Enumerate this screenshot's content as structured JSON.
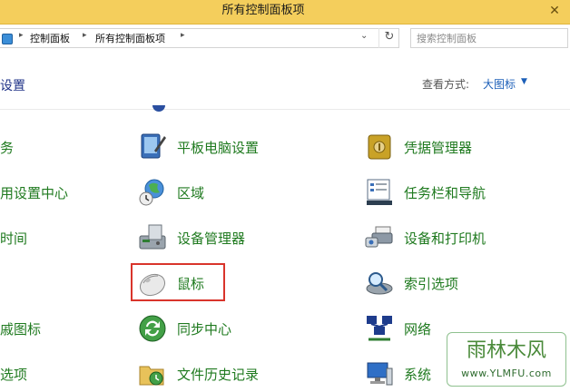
{
  "window": {
    "title": "所有控制面板项",
    "close_glyph": "✕"
  },
  "address_bar": {
    "crumbs": [
      "控制面板",
      "所有控制面板项"
    ],
    "separator": "▸",
    "dropdown_glyph": "⌄",
    "refresh_glyph": "↻"
  },
  "search": {
    "placeholder": "搜索控制面板"
  },
  "header": {
    "title_fragment": "设置",
    "view_label": "查看方式:",
    "view_value": "大图标",
    "view_caret": "▼"
  },
  "left_fragments": [
    "务",
    "用设置中心",
    "时间",
    "戚图标",
    "选项"
  ],
  "items_col2": [
    {
      "label": "平板电脑设置",
      "icon": "tablet-pc-settings-icon"
    },
    {
      "label": "区域",
      "icon": "region-globe-icon"
    },
    {
      "label": "设备管理器",
      "icon": "device-manager-icon"
    },
    {
      "label": "鼠标",
      "icon": "mouse-icon"
    },
    {
      "label": "同步中心",
      "icon": "sync-center-icon"
    },
    {
      "label": "文件历史记录",
      "icon": "file-history-icon"
    }
  ],
  "items_col3": [
    {
      "label": "凭据管理器",
      "icon": "credential-manager-icon"
    },
    {
      "label": "任务栏和导航",
      "icon": "taskbar-navigation-icon"
    },
    {
      "label": "设备和打印机",
      "icon": "devices-printers-icon"
    },
    {
      "label": "索引选项",
      "icon": "indexing-options-icon"
    },
    {
      "label": "网络",
      "icon": "network-icon"
    },
    {
      "label": "系统",
      "icon": "system-icon"
    }
  ],
  "watermark": {
    "logo_text": "雨林木风",
    "url": "www.YLMFU.com"
  },
  "colors": {
    "titlebar": "#f4ce5c",
    "link_green": "#1f7a1f",
    "header_blue": "#1e3287",
    "highlight_red": "#d9342b"
  }
}
